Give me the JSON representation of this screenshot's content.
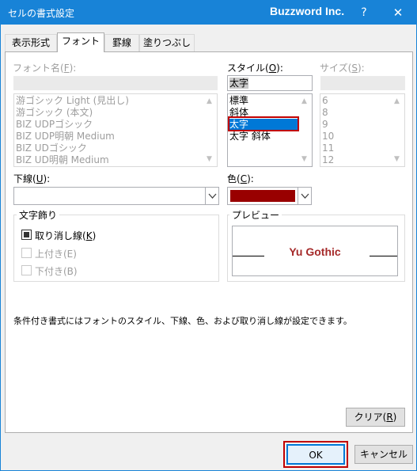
{
  "window": {
    "title": "セルの書式設定",
    "brand": "Buzzword Inc.",
    "help_label": "?",
    "close_label": "✕"
  },
  "tabs": [
    {
      "label": "表示形式"
    },
    {
      "label": "フォント"
    },
    {
      "label": "罫線"
    },
    {
      "label": "塗りつぶし"
    }
  ],
  "font": {
    "label_pre": "フォント名(",
    "label_key": "F",
    "label_post": "):",
    "value": "",
    "items": [
      "游ゴシック Light (見出し)",
      "游ゴシック (本文)",
      "BIZ UDPゴシック",
      "BIZ UDP明朝 Medium",
      "BIZ UDゴシック",
      "BIZ UD明朝 Medium"
    ]
  },
  "style": {
    "label_pre": "スタイル(",
    "label_key": "O",
    "label_post": "):",
    "value": "太字",
    "items": [
      "標準",
      "斜体",
      "太字",
      "太字 斜体"
    ],
    "selected": "太字"
  },
  "size": {
    "label_pre": "サイズ(",
    "label_key": "S",
    "label_post": "):",
    "value": "",
    "items": [
      "6",
      "8",
      "9",
      "10",
      "11",
      "12"
    ]
  },
  "underline": {
    "label_pre": "下線(",
    "label_key": "U",
    "label_post": "):",
    "value": ""
  },
  "color": {
    "label_pre": "色(",
    "label_key": "C",
    "label_post": "):",
    "swatch": "#990000"
  },
  "effects": {
    "title": "文字飾り",
    "strikethrough_pre": "取り消し線(",
    "strikethrough_key": "K",
    "strikethrough_post": ")",
    "strikethrough_checked": true,
    "superscript": "上付き(E)",
    "subscript": "下付き(B)"
  },
  "preview": {
    "title": "プレビュー",
    "sample": "Yu Gothic",
    "sample_color": "#a52a2a"
  },
  "info_text": "条件付き書式にはフォントのスタイル、下線、色、および取り消し線が設定できます。",
  "buttons": {
    "clear_pre": "クリア(",
    "clear_key": "R",
    "clear_post": ")",
    "ok": "OK",
    "cancel": "キャンセル"
  },
  "colors": {
    "accent": "#1883d7",
    "selection": "#0078d7",
    "highlight_frame": "#c00000"
  }
}
